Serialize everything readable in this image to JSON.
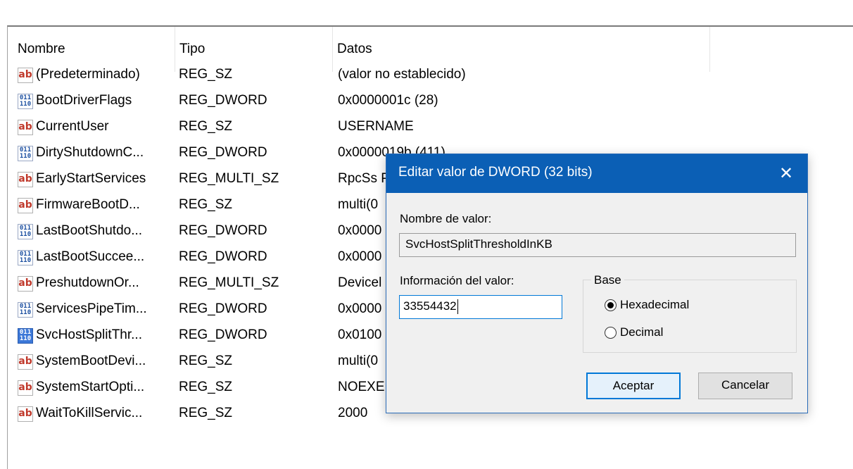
{
  "columns": {
    "name": "Nombre",
    "type": "Tipo",
    "data": "Datos"
  },
  "rows": [
    {
      "icon": "string-value-icon",
      "name": "(Predeterminado)",
      "type": "REG_SZ",
      "data": "(valor no establecido)"
    },
    {
      "icon": "binary-value-icon",
      "name": "BootDriverFlags",
      "type": "REG_DWORD",
      "data": "0x0000001c (28)"
    },
    {
      "icon": "string-value-icon",
      "name": "CurrentUser",
      "type": "REG_SZ",
      "data": "USERNAME"
    },
    {
      "icon": "binary-value-icon",
      "name": "DirtyShutdownC...",
      "type": "REG_DWORD",
      "data": "0x0000019b (411)"
    },
    {
      "icon": "string-value-icon",
      "name": "EarlyStartServices",
      "type": "REG_MULTI_SZ",
      "data": "RpcSs P"
    },
    {
      "icon": "string-value-icon",
      "name": "FirmwareBootD...",
      "type": "REG_SZ",
      "data": "multi(0"
    },
    {
      "icon": "binary-value-icon",
      "name": "LastBootShutdo...",
      "type": "REG_DWORD",
      "data": "0x0000"
    },
    {
      "icon": "binary-value-icon",
      "name": "LastBootSuccee...",
      "type": "REG_DWORD",
      "data": "0x0000"
    },
    {
      "icon": "string-value-icon",
      "name": "PreshutdownOr...",
      "type": "REG_MULTI_SZ",
      "data": "Devicel"
    },
    {
      "icon": "binary-value-icon",
      "name": "ServicesPipeTim...",
      "type": "REG_DWORD",
      "data": "0x0000"
    },
    {
      "icon": "binary-value-icon",
      "name": "SvcHostSplitThr...",
      "type": "REG_DWORD",
      "data": "0x0100"
    },
    {
      "icon": "string-value-icon",
      "name": "SystemBootDevi...",
      "type": "REG_SZ",
      "data": "multi(0"
    },
    {
      "icon": "string-value-icon",
      "name": "SystemStartOpti...",
      "type": "REG_SZ",
      "data": " NOEXE"
    },
    {
      "icon": "string-value-icon",
      "name": "WaitToKillServic...",
      "type": "REG_SZ",
      "data": "2000"
    }
  ],
  "icon_glyphs": {
    "string": "ab",
    "binary": "011\n110"
  },
  "dialog": {
    "title": "Editar valor de DWORD (32 bits)",
    "close_glyph": "✕",
    "value_name_label": "Nombre de valor:",
    "value_name": "SvcHostSplitThresholdInKB",
    "value_data_label": "Información del valor:",
    "value_data": "33554432",
    "base_label": "Base",
    "base_options": [
      {
        "label": "Hexadecimal",
        "selected": true
      },
      {
        "label": "Decimal",
        "selected": false
      }
    ],
    "ok_label": "Aceptar",
    "cancel_label": "Cancelar"
  },
  "colors": {
    "titlebar": "#0b5fb5",
    "dialog_bg": "#f0f0f0",
    "focus_border": "#0078d7"
  }
}
